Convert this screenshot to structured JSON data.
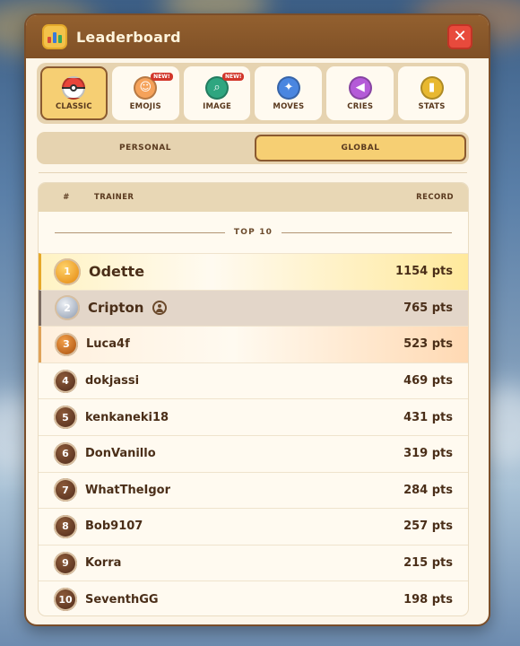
{
  "header": {
    "title": "Leaderboard",
    "close_glyph": "✕"
  },
  "modes": [
    {
      "label": "CLASSIC",
      "icon": "pokeball-icon",
      "active": true,
      "badge": ""
    },
    {
      "label": "EMOJIS",
      "icon": "emoji-icon",
      "active": false,
      "badge": "NEW!"
    },
    {
      "label": "IMAGE",
      "icon": "magnifier-icon",
      "active": false,
      "badge": "NEW!"
    },
    {
      "label": "MOVES",
      "icon": "sparkle-icon",
      "active": false,
      "badge": ""
    },
    {
      "label": "CRIES",
      "icon": "speaker-icon",
      "active": false,
      "badge": ""
    },
    {
      "label": "STATS",
      "icon": "bar-chart-icon",
      "active": false,
      "badge": ""
    }
  ],
  "scope": {
    "personal": "PERSONAL",
    "global": "GLOBAL",
    "active": "global"
  },
  "table": {
    "col_rank": "#",
    "col_trainer": "TRAINER",
    "col_record": "RECORD",
    "section_label": "TOP 10",
    "rows": [
      {
        "rank": "1",
        "name": "Odette",
        "score": "1154 pts"
      },
      {
        "rank": "2",
        "name": "Cripton",
        "score": "765 pts"
      },
      {
        "rank": "3",
        "name": "Luca4f",
        "score": "523 pts"
      },
      {
        "rank": "4",
        "name": "dokjassi",
        "score": "469 pts"
      },
      {
        "rank": "5",
        "name": "kenkaneki18",
        "score": "431 pts"
      },
      {
        "rank": "6",
        "name": "DonVanillo",
        "score": "319 pts"
      },
      {
        "rank": "7",
        "name": "WhatTheIgor",
        "score": "284 pts"
      },
      {
        "rank": "8",
        "name": "Bob9107",
        "score": "257 pts"
      },
      {
        "rank": "9",
        "name": "Korra",
        "score": "215 pts"
      },
      {
        "rank": "10",
        "name": "SeventhGG",
        "score": "198 pts"
      }
    ]
  },
  "colors": {
    "accent": "#f6cf73",
    "header": "#8a5a30",
    "close": "#e84a3c"
  }
}
